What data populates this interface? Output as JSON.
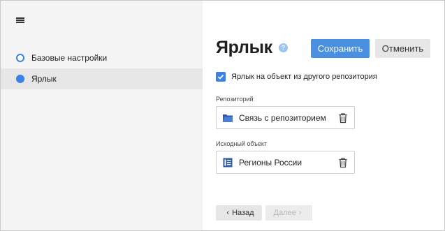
{
  "sidebar": {
    "steps": [
      {
        "label": "Базовые настройки",
        "state": "incomplete"
      },
      {
        "label": "Ярлык",
        "state": "active"
      }
    ]
  },
  "main": {
    "title": "Ярлык",
    "help_icon": "question-icon",
    "save_label": "Сохранить",
    "cancel_label": "Отменить",
    "checkbox": {
      "label": "Ярлык на объект из другого репозитория",
      "checked": true
    },
    "repository": {
      "label": "Репозиторий",
      "value": "Связь с репозиторием",
      "icon": "folder-icon"
    },
    "source_object": {
      "label": "Исходный объект",
      "value": "Регионы России",
      "icon": "dictionary-icon"
    },
    "back_label": "Назад",
    "next_label": "Далее"
  },
  "colors": {
    "accent": "#4a90e2",
    "sidebar_bg": "#f4f4f4",
    "active_step_bg": "#e6e6e6",
    "help_icon": "#9cc3f2"
  }
}
